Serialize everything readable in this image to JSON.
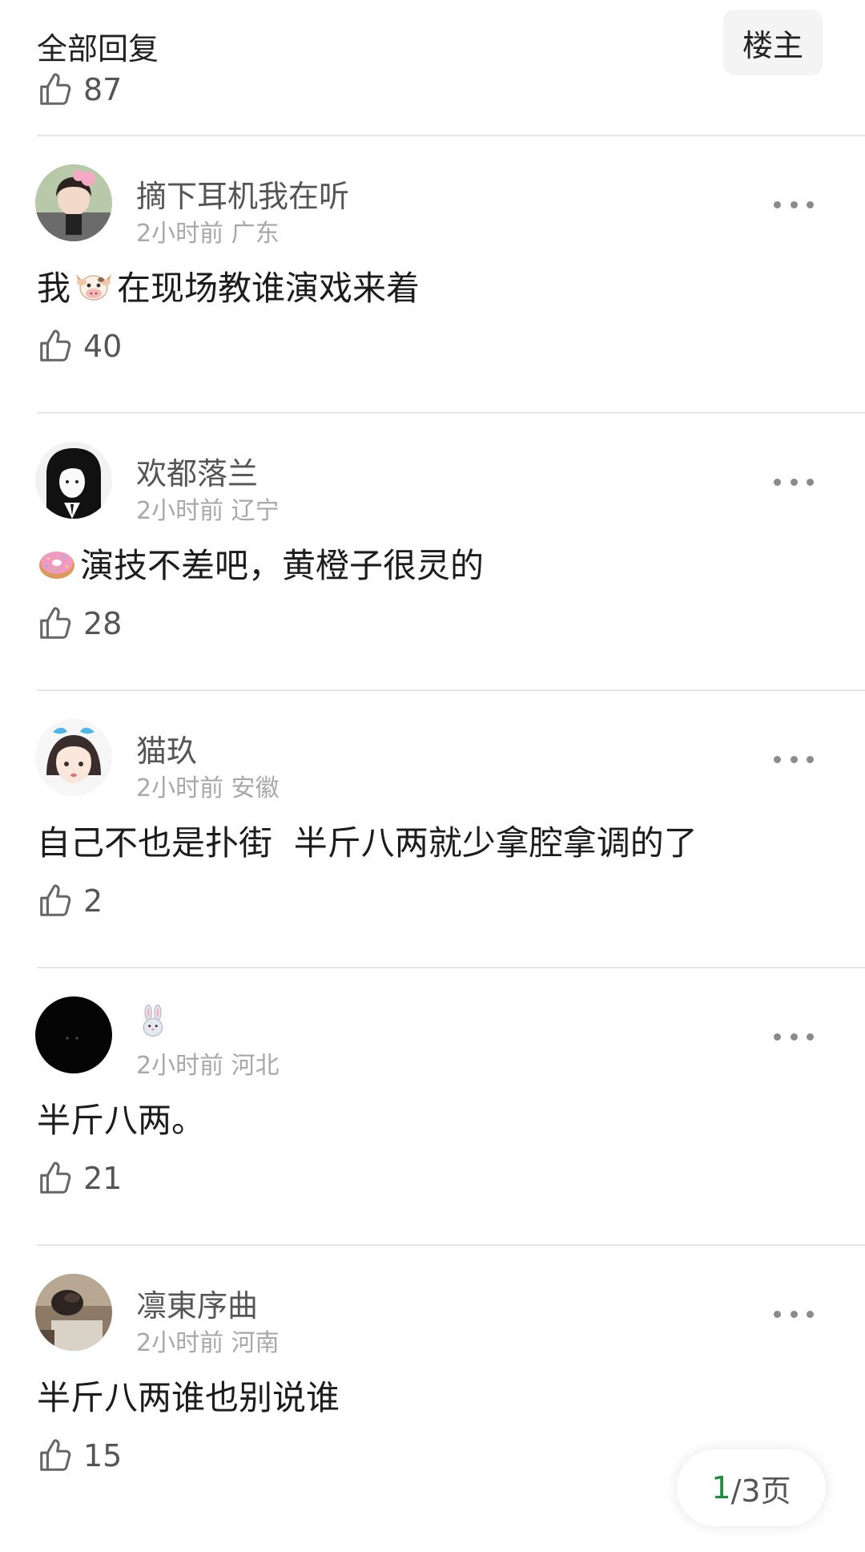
{
  "header": {
    "title": "全部回复",
    "owner_button": "楼主"
  },
  "top_post": {
    "likes": "87"
  },
  "comments": [
    {
      "username": "摘下耳机我在听",
      "time": "2小时前",
      "location": "广东",
      "text_before": "我",
      "emoji": "cow-emoji",
      "text_after": "在现场教谁演戏来着",
      "likes": "40"
    },
    {
      "username": "欢都落兰",
      "time": "2小时前",
      "location": "辽宁",
      "text_before": "",
      "emoji": "donut-emoji",
      "text_after": "演技不差吧，黄橙子很灵的",
      "likes": "28"
    },
    {
      "username": "猫玖",
      "time": "2小时前",
      "location": "安徽",
      "text_before": "",
      "emoji": "",
      "text_after": "自己不也是扑街  半斤八两就少拿腔拿调的了",
      "likes": "2"
    },
    {
      "username": "",
      "username_emoji": "rabbit-emoji",
      "time": "2小时前",
      "location": "河北",
      "text_before": "",
      "emoji": "",
      "text_after": "半斤八两。",
      "likes": "21"
    },
    {
      "username": "凛東序曲",
      "time": "2小时前",
      "location": "河南",
      "text_before": "",
      "emoji": "",
      "text_after": "半斤八两谁也别说谁",
      "likes": "15"
    }
  ],
  "pager": {
    "current": "1",
    "total": "/3页"
  },
  "colors": {
    "accent": "#1a8f3a",
    "divider": "#e6e6e6",
    "meta": "#a8a8a8"
  },
  "icons": [
    "thumbs-up-icon",
    "more-icon"
  ]
}
